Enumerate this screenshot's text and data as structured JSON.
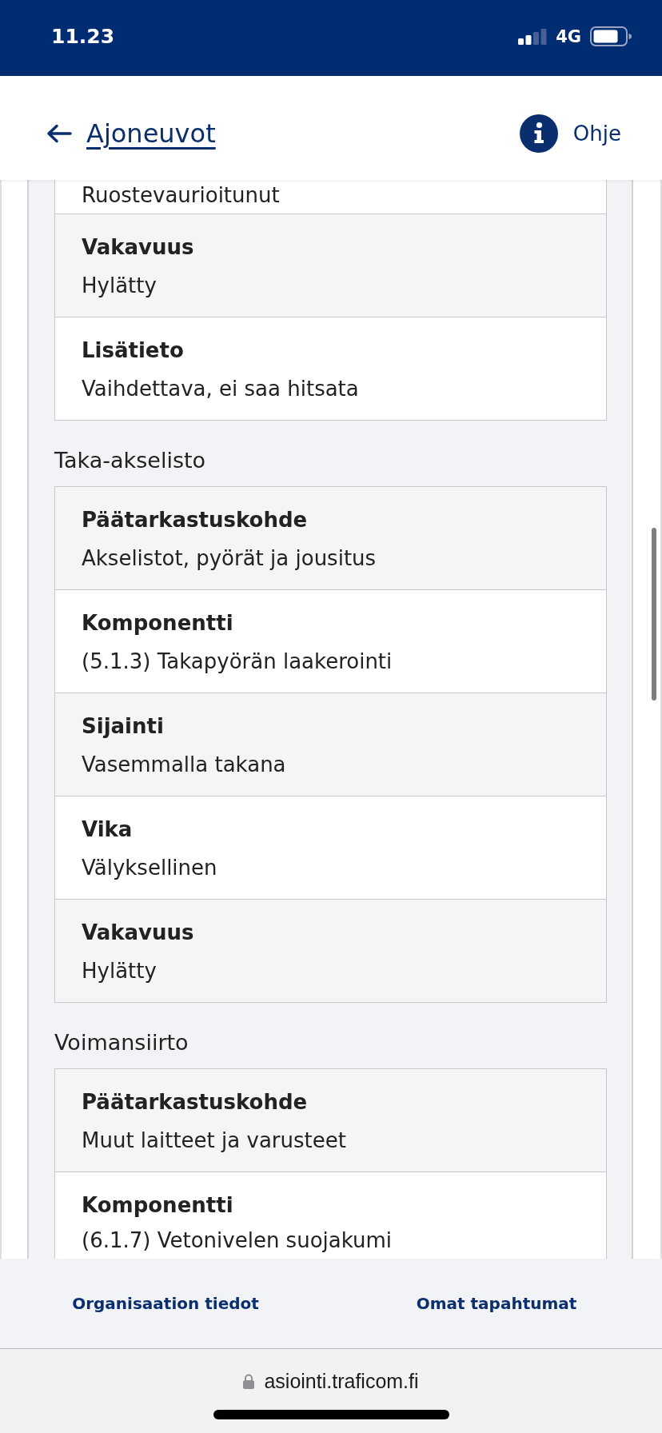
{
  "status_bar": {
    "time": "11.23",
    "network": "4G"
  },
  "header": {
    "back_link": "Ajoneuvot",
    "help_link": "Ohje"
  },
  "sections": [
    {
      "continued_value": "Ruostevaurioitunut",
      "rows": [
        {
          "label": "Vakavuus",
          "value": "Hylätty"
        },
        {
          "label": "Lisätieto",
          "value": "Vaihdettava, ei saa hitsata"
        }
      ]
    },
    {
      "heading": "Taka-akselisto",
      "rows": [
        {
          "label": "Päätarkastuskohde",
          "value": "Akselistot, pyörät ja jousitus"
        },
        {
          "label": "Komponentti",
          "value": "(5.1.3) Takapyörän laakerointi"
        },
        {
          "label": "Sijainti",
          "value": "Vasemmalla takana"
        },
        {
          "label": "Vika",
          "value": "Välyksellinen"
        },
        {
          "label": "Vakavuus",
          "value": "Hylätty"
        }
      ]
    },
    {
      "heading": "Voimansiirto",
      "rows": [
        {
          "label": "Päätarkastuskohde",
          "value": "Muut laitteet ja varusteet"
        },
        {
          "label": "Komponentti",
          "value": "(6.1.7) Vetonivelen suojakumi"
        }
      ]
    }
  ],
  "footer": {
    "links": [
      "Organisaation tiedot",
      "Omat tapahtumat"
    ]
  },
  "browser": {
    "url": "asiointi.traficom.fi"
  }
}
